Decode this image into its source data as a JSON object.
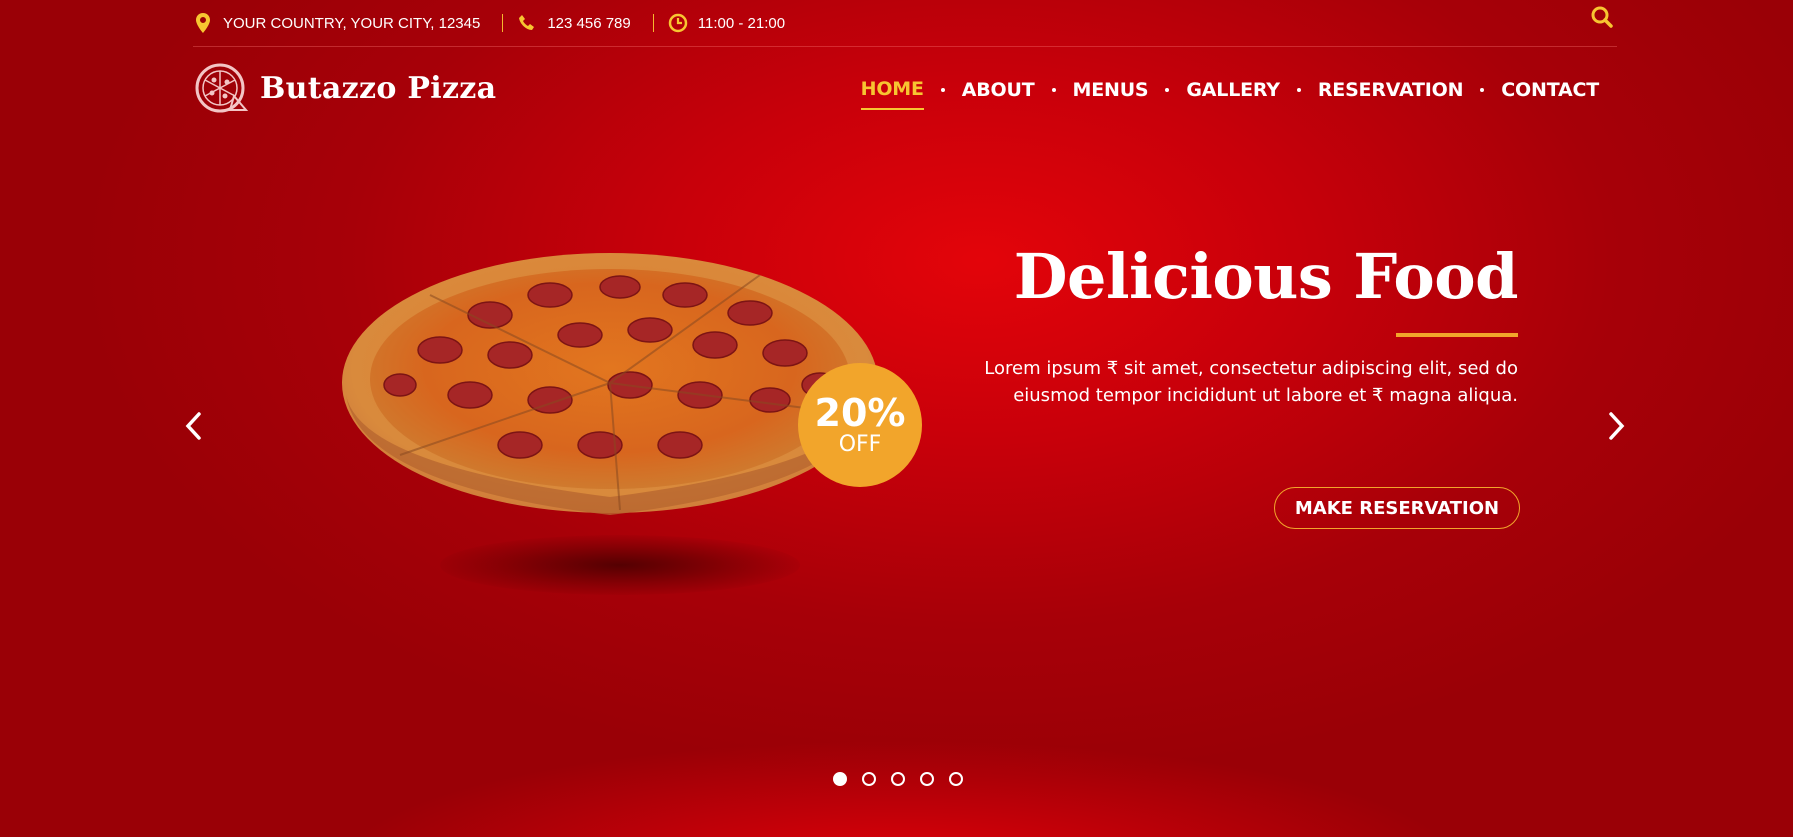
{
  "topbar": {
    "address": "YOUR COUNTRY, YOUR CITY, 12345",
    "phone": "123 456 789",
    "hours": "11:00 - 21:00",
    "icons": [
      "map-marker-icon",
      "phone-icon",
      "clock-icon",
      "search-icon"
    ]
  },
  "brand": {
    "name": "Butazzo Pizza",
    "logo_icon": "pizza-logo-icon"
  },
  "nav": {
    "items": [
      {
        "label": "HOME",
        "active": true
      },
      {
        "label": "ABOUT",
        "active": false
      },
      {
        "label": "MENUS",
        "active": false
      },
      {
        "label": "GALLERY",
        "active": false
      },
      {
        "label": "RESERVATION",
        "active": false
      },
      {
        "label": "CONTACT",
        "active": false
      }
    ]
  },
  "hero": {
    "title": "Delicious Food",
    "text": "Lorem ipsum ₹ sit amet, consectetur adipiscing elit, sed do eiusmod tempor incididunt ut labore et ₹ magna aliqua.",
    "cta_label": "MAKE RESERVATION",
    "badge_percent": "20%",
    "badge_off": "OFF",
    "image": "pepperoni-pizza"
  },
  "slider": {
    "slide_count": 5,
    "active_index": 0,
    "prev_icon": "chevron-left-icon",
    "next_icon": "chevron-right-icon"
  },
  "colors": {
    "background": "#c8000a",
    "accent": "#f2a52b",
    "active_nav": "#f7c531",
    "text": "#ffffff"
  }
}
